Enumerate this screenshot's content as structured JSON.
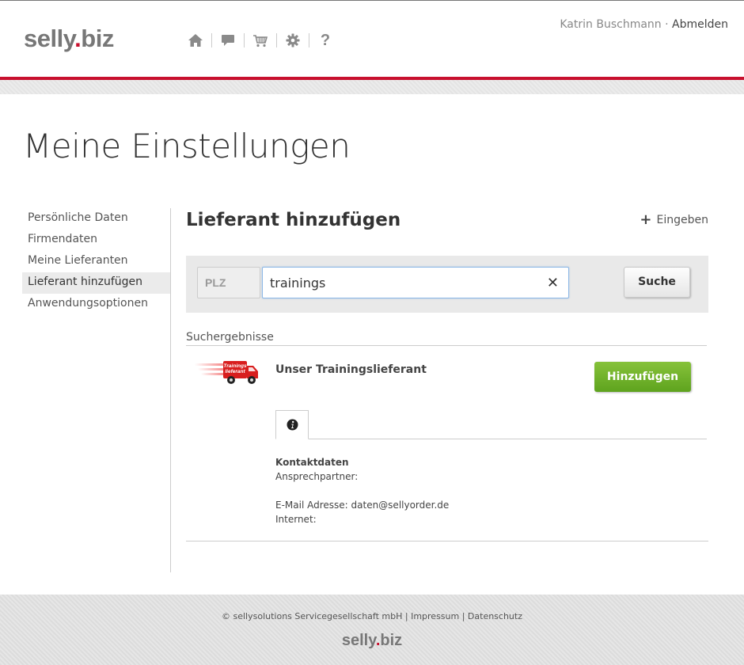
{
  "header": {
    "logo_main": "selly",
    "logo_dot": ".",
    "logo_tld": "biz",
    "user_name": "Katrin Buschmann",
    "separator": " · ",
    "logout_label": "Abmelden",
    "icons": [
      "home-icon",
      "chat-icon",
      "cart-icon",
      "gear-icon",
      "help-icon"
    ]
  },
  "page": {
    "title": "Meine Einstellungen"
  },
  "sidebar": {
    "items": [
      {
        "label": "Persönliche Daten"
      },
      {
        "label": "Firmendaten"
      },
      {
        "label": "Meine Lieferanten"
      },
      {
        "label": "Lieferant hinzufügen",
        "active": true
      },
      {
        "label": "Anwendungsoptionen"
      }
    ]
  },
  "main": {
    "title": "Lieferant hinzufügen",
    "enter_label": "Eingeben",
    "search": {
      "plz_placeholder": "PLZ",
      "query_value": "trainings",
      "clear_symbol": "✕",
      "button_label": "Suche"
    },
    "results_label": "Suchergebnisse",
    "result": {
      "logo_text_1": "Trainings",
      "logo_text_2": "lieferant",
      "name": "Unser Trainingslieferant",
      "add_label": "Hinzufügen",
      "contact_heading": "Kontaktdaten",
      "contact_person_label": "Ansprechpartner:",
      "email_line": "E-Mail Adresse: daten@sellyorder.de",
      "internet_label": "Internet:"
    }
  },
  "footer": {
    "copyright": "© sellysolutions Servicegesellschaft mbH",
    "impressum": "Impressum",
    "datenschutz": "Datenschutz",
    "sep": " | ",
    "logo_main": "selly",
    "logo_dot": ".",
    "logo_tld": "biz"
  },
  "colors": {
    "brand_red": "#c8102e",
    "add_green": "#6db32a",
    "focus_blue": "#8cb8e6"
  }
}
